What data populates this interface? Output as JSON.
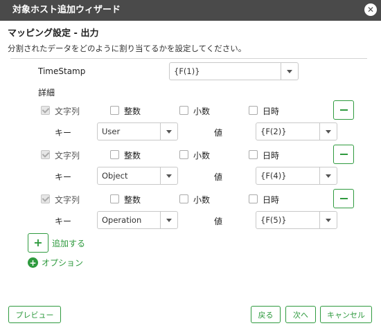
{
  "dialog": {
    "title": "対象ホスト追加ウィザード",
    "close_glyph": "✕"
  },
  "section": {
    "title": "マッピング設定 - 出力",
    "description": "分割されたデータをどのように割り当てるかを設定してください。"
  },
  "timestamp": {
    "label": "TimeStamp",
    "value": "{F(1)}"
  },
  "details_label": "詳細",
  "rows": [
    {
      "types": [
        {
          "label": "文字列",
          "checked": true
        },
        {
          "label": "整数",
          "checked": false
        },
        {
          "label": "小数",
          "checked": false
        },
        {
          "label": "日時",
          "checked": false
        }
      ],
      "key_label": "キー",
      "key_value": "User",
      "value_label": "値",
      "value_value": "{F(2)}"
    },
    {
      "types": [
        {
          "label": "文字列",
          "checked": true
        },
        {
          "label": "整数",
          "checked": false
        },
        {
          "label": "小数",
          "checked": false
        },
        {
          "label": "日時",
          "checked": false
        }
      ],
      "key_label": "キー",
      "key_value": "Object",
      "value_label": "値",
      "value_value": "{F(4)}"
    },
    {
      "types": [
        {
          "label": "文字列",
          "checked": true
        },
        {
          "label": "整数",
          "checked": false
        },
        {
          "label": "小数",
          "checked": false
        },
        {
          "label": "日時",
          "checked": false
        }
      ],
      "key_label": "キー",
      "key_value": "Operation",
      "value_label": "値",
      "value_value": "{F(5)}"
    }
  ],
  "add": {
    "icon": "+",
    "label": "追加する"
  },
  "options": {
    "icon": "+",
    "label": "オプション"
  },
  "footer": {
    "preview": "プレビュー",
    "back": "戻る",
    "next": "次へ",
    "cancel": "キャンセル"
  },
  "colors": {
    "accent_green": "#2e9a3e",
    "title_bar": "#4a4a4a"
  }
}
